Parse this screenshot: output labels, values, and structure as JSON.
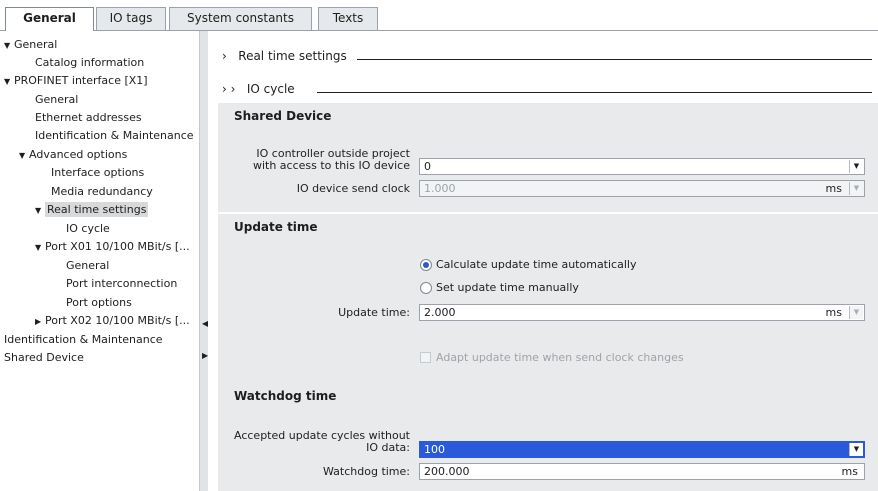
{
  "tabs": [
    {
      "label": "General",
      "active": true
    },
    {
      "label": "IO tags",
      "active": false
    },
    {
      "label": "System constants",
      "active": false
    },
    {
      "label": "Texts",
      "active": false
    }
  ],
  "tree": [
    {
      "label": "General",
      "expanded": true
    },
    {
      "label": "Catalog information"
    },
    {
      "label": "PROFINET interface [X1]",
      "expanded": true
    },
    {
      "label": "General"
    },
    {
      "label": "Ethernet addresses"
    },
    {
      "label": "Identification & Maintenance"
    },
    {
      "label": "Advanced options",
      "expanded": true
    },
    {
      "label": "Interface options"
    },
    {
      "label": "Media redundancy"
    },
    {
      "label": "Real time settings",
      "expanded": true,
      "selected": true
    },
    {
      "label": "IO cycle"
    },
    {
      "label": "Port X01 10/100 MBit/s [...",
      "expanded": true
    },
    {
      "label": "General"
    },
    {
      "label": "Port interconnection"
    },
    {
      "label": "Port options"
    },
    {
      "label": "Port X02 10/100 MBit/s [...",
      "expanded": false
    },
    {
      "label": "Identification & Maintenance"
    },
    {
      "label": "Shared Device"
    }
  ],
  "breadcrumbs": {
    "real_time": {
      "arrows": "›",
      "label": "Real time settings"
    },
    "io_cycle": {
      "arrows": "›  ›",
      "label": "IO cycle"
    }
  },
  "shared_device": {
    "title": "Shared Device",
    "controller_label_line1": "IO controller outside project",
    "controller_label_line2": "with access to this IO device",
    "controller_value": "0",
    "send_clock_label": "IO device send clock",
    "send_clock_value": "1.000",
    "send_clock_unit": "ms"
  },
  "update_time": {
    "title": "Update time",
    "option_auto": "Calculate update time automatically",
    "option_manual": "Set update time manually",
    "selected": "auto",
    "field_label": "Update time:",
    "value": "2.000",
    "unit": "ms",
    "adapt_label": "Adapt update time when send clock changes"
  },
  "watchdog": {
    "title": "Watchdog time",
    "cycles_label_line1": "Accepted update cycles without",
    "cycles_label_line2": "IO data:",
    "cycles_value": "100",
    "time_label": "Watchdog time:",
    "time_value": "200.000",
    "time_unit": "ms"
  },
  "colors": {
    "accent": "#2a5ad7",
    "section_bg": "#e8eaec",
    "selected_row": "#d7d9db"
  }
}
